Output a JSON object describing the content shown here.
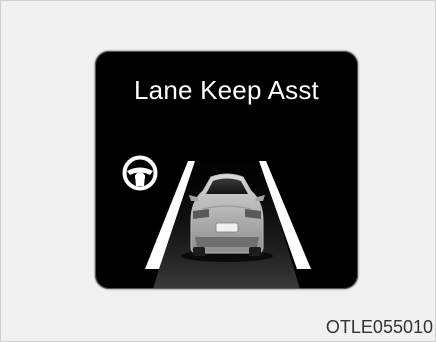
{
  "display": {
    "title": "Lane Keep Asst",
    "indicator_icon": "steering-wheel-icon",
    "lane_lines": "left-and-right",
    "vehicle_icon": "car-rear-view-icon"
  },
  "figure_code": "OTLE055010"
}
